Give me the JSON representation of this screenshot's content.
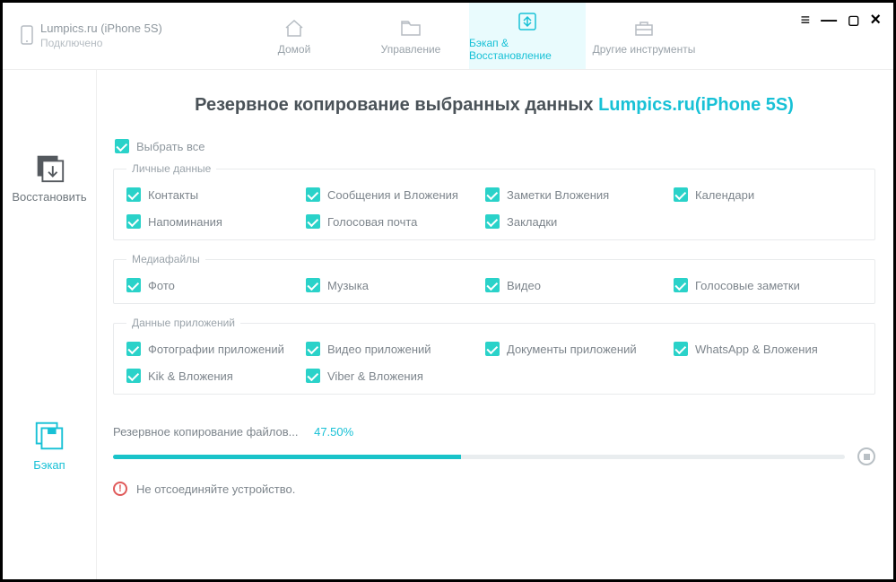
{
  "device": {
    "name": "Lumpics.ru (iPhone 5S)",
    "status": "Подключено"
  },
  "nav": {
    "home": "Домой",
    "manage": "Управление",
    "backup": "Бэкап & Восстановление",
    "tools": "Другие инструменты"
  },
  "sidebar": {
    "restore": "Восстановить",
    "backup": "Бэкап"
  },
  "heading": {
    "prefix": "Резервное копирование выбранных данных ",
    "accent": "Lumpics.ru(iPhone 5S)"
  },
  "select_all": "Выбрать все",
  "groups": {
    "personal": {
      "legend": "Личные данные",
      "items": [
        "Контакты",
        "Сообщения и Вложения",
        "Заметки Вложения",
        "Календари",
        "Напоминания",
        "Голосовая почта",
        "Закладки"
      ]
    },
    "media": {
      "legend": "Медиафайлы",
      "items": [
        "Фото",
        "Музыка",
        "Видео",
        "Голосовые заметки"
      ]
    },
    "apps": {
      "legend": "Данные приложений",
      "items": [
        "Фотографии приложений",
        "Видео приложений",
        "Документы приложений",
        "WhatsApp & Вложения",
        "Kik & Вложения",
        "Viber & Вложения"
      ]
    }
  },
  "progress": {
    "label": "Резервное копирование файлов...",
    "percent_text": "47.50%",
    "percent_value": 47.5
  },
  "warning": "Не отсоединяйте устройство.",
  "colors": {
    "accent": "#18c1d6",
    "check": "#2ad2c9"
  }
}
